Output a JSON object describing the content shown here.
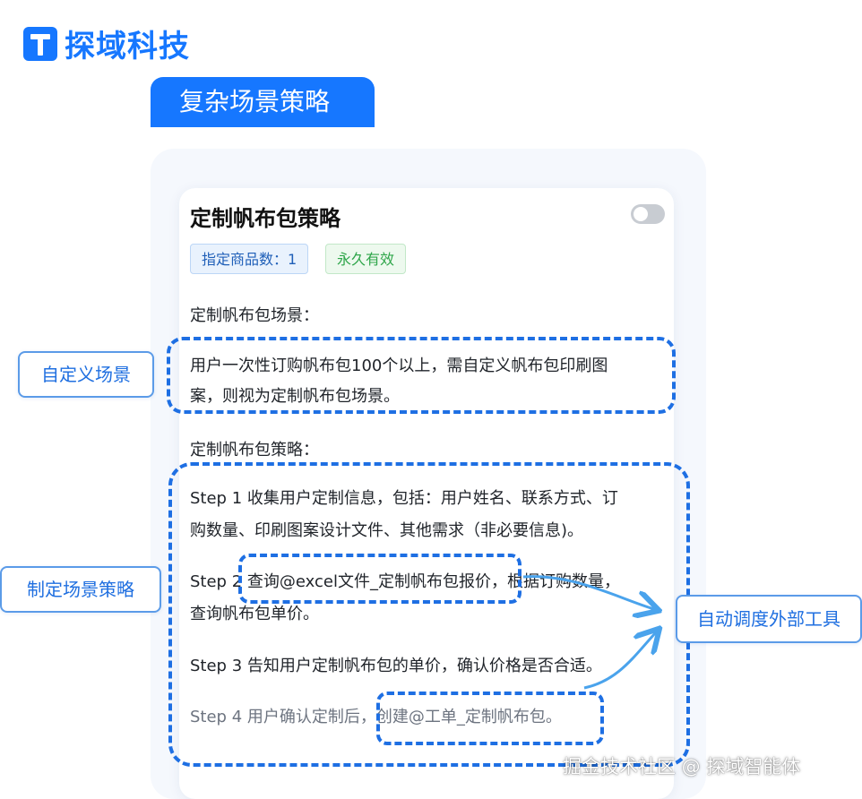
{
  "brand": {
    "name": "探域科技"
  },
  "banner": {
    "title": "复杂场景策略"
  },
  "card": {
    "title": "定制帆布包策略",
    "toggle_on": false,
    "tags": [
      "指定商品数：1",
      "永久有效"
    ],
    "scene_label": "定制帆布包场景：",
    "scene_text_line1": "用户一次性订购帆布包100个以上，需自定义帆布包印刷图",
    "scene_text_line2": "案，则视为定制帆布包场景。",
    "strategy_label": "定制帆布包策略：",
    "steps": [
      {
        "line1": "Step 1 收集用户定制信息，包括：用户姓名、联系方式、订",
        "line2": "购数量、印刷图案设计文件、其他需求（非必要信息)。"
      },
      {
        "line1": "Step 2 查询@excel文件_定制帆布包报价，根据订购数量，",
        "line2": "查询帆布包单价。"
      },
      {
        "line1": "Step 3 告知用户定制帆布包的单价，确认价格是否合适。"
      },
      {
        "line1": "Step 4 用户确认定制后，创建@工单_定制帆布包。"
      }
    ]
  },
  "callouts": {
    "custom_scene": "自定义场景",
    "make_strategy": "制定场景策略",
    "auto_tools": "自动调度外部工具"
  },
  "watermark": "掘金技术社区 @ 探域智能体",
  "colors": {
    "accent": "#1677ff",
    "dash": "#1e6fe3",
    "tag_green": "#2fa64a"
  }
}
